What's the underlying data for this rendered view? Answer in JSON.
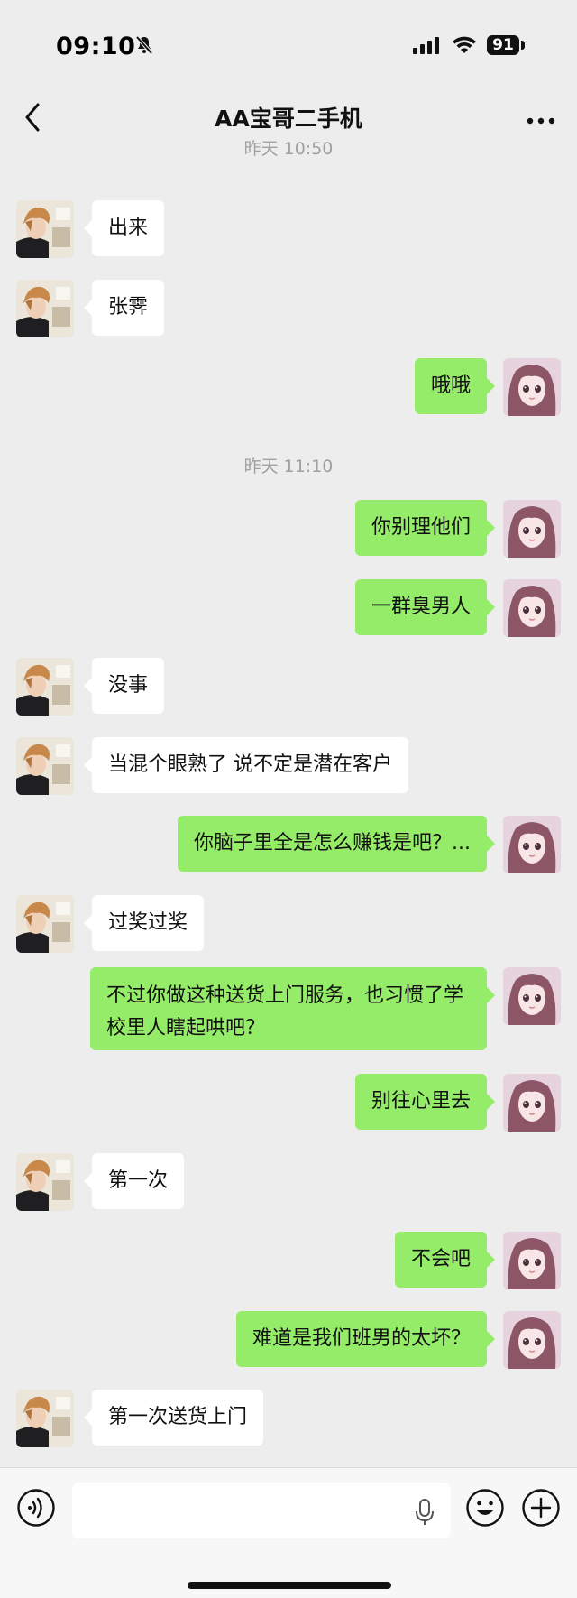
{
  "status_bar": {
    "time": "09:10",
    "battery": "91"
  },
  "header": {
    "title": "AA宝哥二手机"
  },
  "timestamps": [
    "昨天 10:50",
    "昨天 11:10"
  ],
  "messages": [
    {
      "side": "left",
      "text": "出来"
    },
    {
      "side": "left",
      "text": "张霁"
    },
    {
      "side": "right",
      "text": "哦哦"
    },
    {
      "side": "right",
      "text": "你别理他们"
    },
    {
      "side": "right",
      "text": "一群臭男人"
    },
    {
      "side": "left",
      "text": "没事"
    },
    {
      "side": "left",
      "text": "当混个眼熟了 说不定是潜在客户"
    },
    {
      "side": "right",
      "text": "你脑子里全是怎么赚钱是吧？..."
    },
    {
      "side": "left",
      "text": "过奖过奖"
    },
    {
      "side": "right",
      "text": "不过你做这种送货上门服务，也习惯了学校里人瞎起哄吧？"
    },
    {
      "side": "right",
      "text": "别往心里去"
    },
    {
      "side": "left",
      "text": "第一次"
    },
    {
      "side": "right",
      "text": "不会吧"
    },
    {
      "side": "right",
      "text": "难道是我们班男的太坏？"
    },
    {
      "side": "left",
      "text": "第一次送货上门"
    }
  ],
  "colors": {
    "bubble_mine": "#95ec69",
    "bubble_other": "#ffffff",
    "background": "#ededed"
  },
  "icons": [
    "back-arrow",
    "more-dots",
    "voice",
    "mic",
    "emoji",
    "plus"
  ]
}
